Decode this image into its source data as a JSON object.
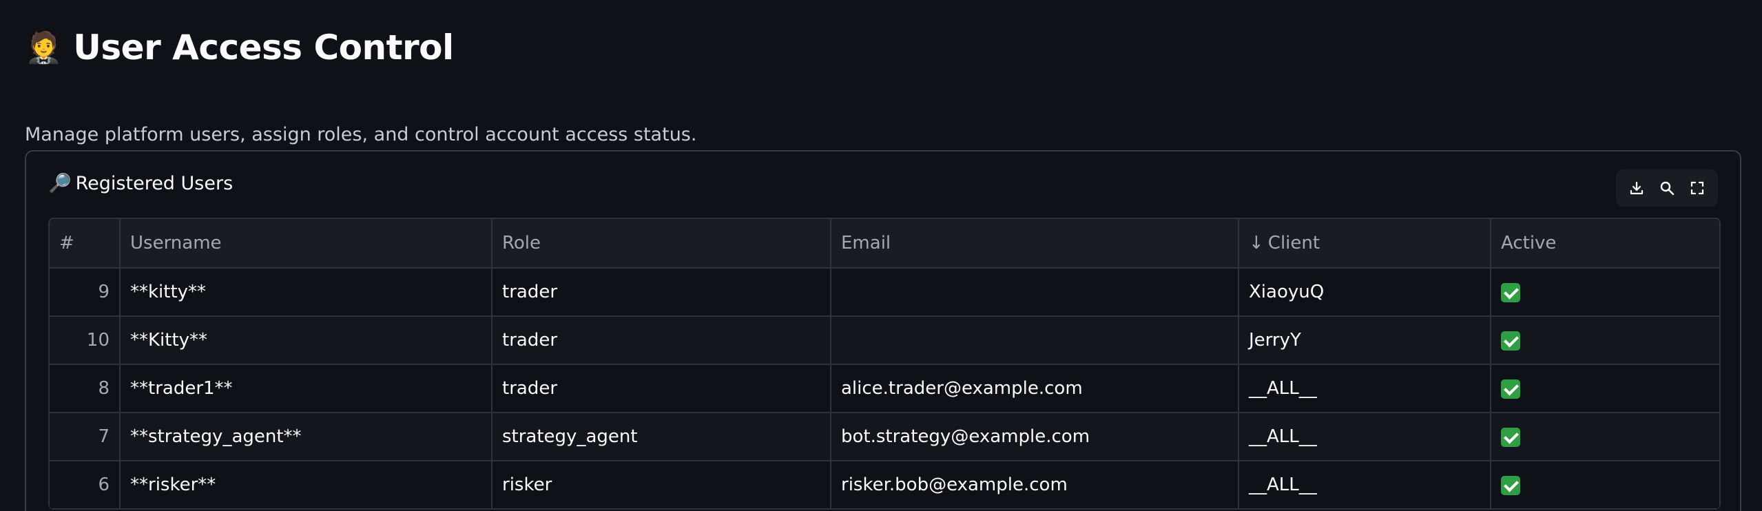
{
  "page": {
    "title_emoji": "🤵",
    "title": "User Access Control",
    "subtitle": "Manage platform users, assign roles, and control account access status."
  },
  "panel": {
    "header_icon": "🔎",
    "header": "Registered Users",
    "toolbar": {
      "download_icon": "download-icon",
      "search_icon": "search-icon",
      "fullscreen_icon": "fullscreen-icon"
    }
  },
  "table": {
    "columns": {
      "index": "#",
      "username": "Username",
      "role": "Role",
      "email": "Email",
      "client_sort": "↓",
      "client": "Client",
      "active": "Active"
    },
    "rows": [
      {
        "index": "9",
        "username": "**kitty**",
        "role": "trader",
        "email": "",
        "client": "XiaoyuQ",
        "active": true
      },
      {
        "index": "10",
        "username": "**Kitty**",
        "role": "trader",
        "email": "",
        "client": "JerryY",
        "active": true
      },
      {
        "index": "8",
        "username": "**trader1**",
        "role": "trader",
        "email": "alice.trader@example.com",
        "client": "__ALL__",
        "active": true
      },
      {
        "index": "7",
        "username": "**strategy_agent**",
        "role": "strategy_agent",
        "email": "bot.strategy@example.com",
        "client": "__ALL__",
        "active": true
      },
      {
        "index": "6",
        "username": "**risker**",
        "role": "risker",
        "email": "risker.bob@example.com",
        "client": "__ALL__",
        "active": true
      }
    ]
  },
  "colors": {
    "background": "#0e1117",
    "active_check": "#2ea043"
  }
}
